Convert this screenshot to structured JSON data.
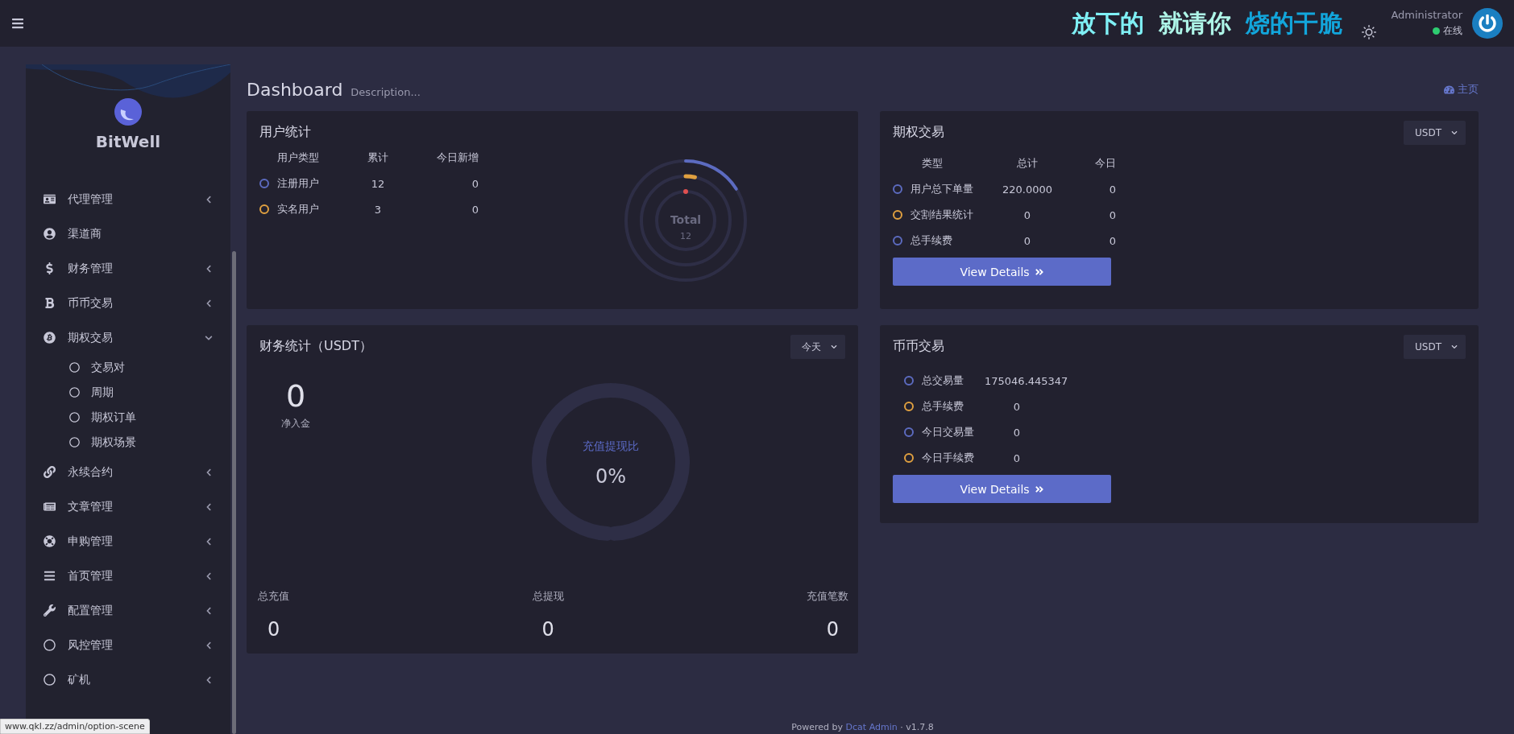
{
  "top_bar": {
    "overlay_text": [
      {
        "text": "放下的",
        "color": "#7ff0f5"
      },
      {
        "text": "就请你",
        "color": "#aef6e8"
      },
      {
        "text": "烧的干脆",
        "color": "#12a6dc"
      }
    ],
    "user": {
      "name": "Administrator",
      "status": "在线"
    }
  },
  "sidebar": {
    "brand": "BitWell",
    "items": [
      {
        "label": "代理管理",
        "kind": "group",
        "expanded": false
      },
      {
        "label": "渠道商",
        "kind": "link"
      },
      {
        "label": "财务管理",
        "kind": "group",
        "expanded": false
      },
      {
        "label": "币币交易",
        "kind": "group",
        "expanded": false
      },
      {
        "label": "期权交易",
        "kind": "group",
        "expanded": true,
        "children": [
          {
            "label": "交易对"
          },
          {
            "label": "周期"
          },
          {
            "label": "期权订单"
          },
          {
            "label": "期权场景"
          }
        ]
      },
      {
        "label": "永续合约",
        "kind": "group",
        "expanded": false
      },
      {
        "label": "文章管理",
        "kind": "group",
        "expanded": false
      },
      {
        "label": "申购管理",
        "kind": "group",
        "expanded": false
      },
      {
        "label": "首页管理",
        "kind": "group",
        "expanded": false
      },
      {
        "label": "配置管理",
        "kind": "group",
        "expanded": false
      },
      {
        "label": "风控管理",
        "kind": "group",
        "expanded": false
      },
      {
        "label": "矿机",
        "kind": "group",
        "expanded": false
      }
    ]
  },
  "header": {
    "title": "Dashboard",
    "description": "Description...",
    "breadcrumb": "主页"
  },
  "user_stats": {
    "title": "用户统计",
    "columns": [
      "用户类型",
      "累计",
      "今日新增"
    ],
    "rows": [
      {
        "name": "注册用户",
        "total": "12",
        "today": "0",
        "color": "#5c6bc0"
      },
      {
        "name": "实名用户",
        "total": "3",
        "today": "0",
        "color": "#e0a040"
      }
    ],
    "ring_label": "Total",
    "ring_value": "12"
  },
  "options": {
    "title": "期权交易",
    "currency": "USDT",
    "columns": [
      "类型",
      "总计",
      "今日"
    ],
    "rows": [
      {
        "name": "用户总下单量",
        "total": "220.0000",
        "today": "0",
        "color": "#5c6bc0"
      },
      {
        "name": "交割结果统计",
        "total": "0",
        "today": "0",
        "color": "#e0a040"
      },
      {
        "name": "总手续费",
        "total": "0",
        "today": "0",
        "color": "#5c6bc0"
      }
    ],
    "button": "View Details"
  },
  "finance": {
    "title": "财务统计（USDT）",
    "period": "今天",
    "net_value": "0",
    "net_label": "净入金",
    "ring_label": "充值提现比",
    "ring_value": "0%",
    "totals": [
      {
        "label": "总充值",
        "value": "0"
      },
      {
        "label": "总提现",
        "value": "0"
      },
      {
        "label": "充值笔数",
        "value": "0"
      }
    ]
  },
  "spot": {
    "title": "币币交易",
    "currency": "USDT",
    "rows": [
      {
        "name": "总交易量",
        "value": "175046.445347",
        "color": "#5c6bc0"
      },
      {
        "name": "总手续费",
        "value": "0",
        "color": "#e0a040"
      },
      {
        "name": "今日交易量",
        "value": "0",
        "color": "#5c6bc0"
      },
      {
        "name": "今日手续费",
        "value": "0",
        "color": "#e0a040"
      }
    ],
    "button": "View Details"
  },
  "footer": {
    "prefix": "Powered by",
    "link": "Dcat Admin",
    "version": "· v1.7.8"
  },
  "status_url": "www.qkl.zz/admin/option-scene"
}
